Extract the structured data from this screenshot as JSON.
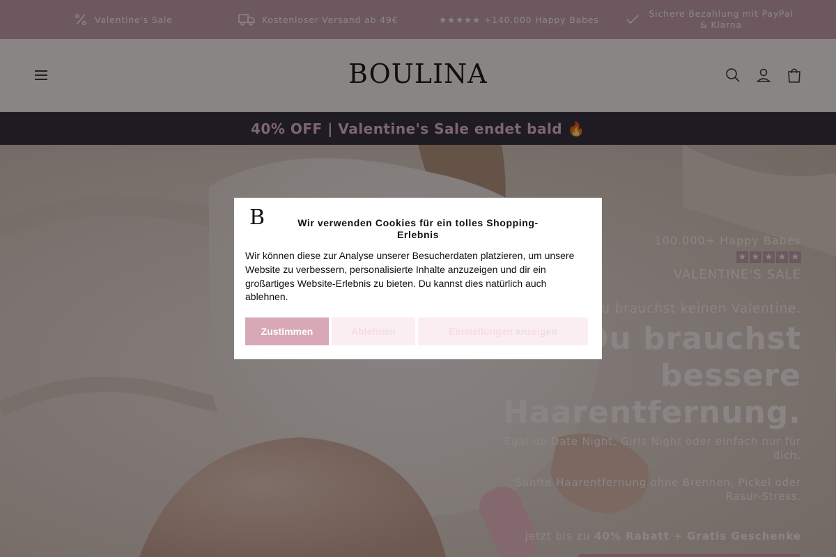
{
  "infobar": {
    "items": [
      {
        "icon": "percent-icon",
        "text": "Valentine's Sale"
      },
      {
        "icon": "truck-icon",
        "text": "Kostenloser Versand ab 49€"
      },
      {
        "icon": "",
        "text": "★★★★★ +140.000 Happy Babes"
      },
      {
        "icon": "checkmark-icon",
        "text": "Sichere Bezahlung mit PayPal & Klarna"
      }
    ]
  },
  "header": {
    "logo": "BOULINA",
    "icons": [
      "menu-icon",
      "search-icon",
      "account-icon",
      "cart-icon"
    ]
  },
  "announcement": {
    "text": "40% OFF | Valentine's Sale endet bald 🔥"
  },
  "hero": {
    "kicker": "100.000+ Happy Babes",
    "stars": [
      "★",
      "★",
      "★",
      "★",
      "★"
    ],
    "sale": "VALENTINE'S SALE",
    "subheading": "Du brauchst keinen Valentine.",
    "title": "Du brauchst bessere Haarentfernung.",
    "p1": "Egal ob Date Night, Girls Night oder einfach nur für dich.",
    "p2": "Sanfte Haarentfernung ohne Brennen, Pickel oder Rasur-Stress.",
    "offer_prefix": "Jetzt bis zu ",
    "offer_bold1": "40% Rabatt",
    "offer_mid": " + ",
    "offer_bold2": "Gratis Geschenke"
  },
  "cookie": {
    "logo": "B",
    "title": "Wir verwenden Cookies für ein tolles Shopping-Erlebnis",
    "body": "Wir können diese zur Analyse unserer Besucherdaten platzieren, um unsere Website zu verbessern, personalisierte Inhalte anzuzeigen und dir ein großartiges Website-Erlebnis zu bieten. Du kannst dies natürlich auch ablehnen.",
    "accept": "Zustimmen",
    "decline": "Ablehnen",
    "settings": "Einstellungen anzeigen"
  },
  "colors": {
    "infobar": "#c8a4b2",
    "announcement_bg": "#2a2a3a",
    "announcement_text": "#e7c0d0",
    "accent": "#d8a8b6"
  }
}
